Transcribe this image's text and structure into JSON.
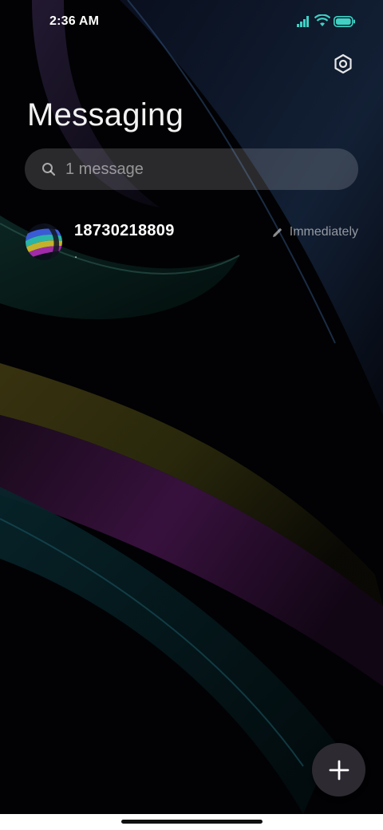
{
  "status_bar": {
    "time": "2:36 AM",
    "icons": [
      "signal-icon",
      "wifi-icon",
      "battery-icon"
    ],
    "accent_color": "#3fd1c4"
  },
  "header": {
    "title": "Messaging",
    "settings_icon": "gear-icon"
  },
  "search": {
    "placeholder": "1 message",
    "icon": "search-icon"
  },
  "conversations": [
    {
      "name": "18730218809",
      "snippet": ".",
      "time": "Immediately",
      "status_icon": "pencil-icon",
      "avatar": "avatar"
    }
  ],
  "fab": {
    "icon": "plus-icon"
  },
  "colors": {
    "background": "#020204",
    "fab": "#2d2a31",
    "search_bg": "rgba(255,255,255,0.16)"
  }
}
